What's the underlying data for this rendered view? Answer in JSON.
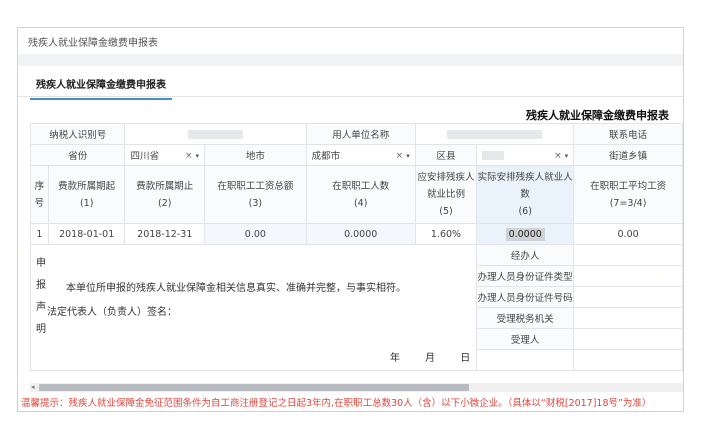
{
  "window": {
    "title": "残疾人就业保障金缴费申报表"
  },
  "tab": {
    "label": "残疾人就业保障金缴费申报表"
  },
  "form": {
    "title": "残疾人就业保障金缴费申报表"
  },
  "row1": {
    "taxpayer_id_label": "纳税人识别号",
    "employer_name_label": "用人单位名称",
    "phone_label": "联系电话"
  },
  "row2": {
    "province_label": "省份",
    "province_value": "四川省",
    "city_label": "地市",
    "city_value": "成都市",
    "district_label": "区县",
    "street_label": "街道乡镇"
  },
  "header": {
    "seq": "序号",
    "period_start": "费款所属期起",
    "period_start_n": "(1)",
    "period_end": "费款所属期止",
    "period_end_n": "(2)",
    "total_wage": "在职职工工资总额",
    "total_wage_n": "(3)",
    "staff_count": "在职职工人数",
    "staff_count_n": "(4)",
    "ratio": "应安排残疾人就业比例",
    "ratio_n": "(5)",
    "actual": "实际安排残疾人就业人数",
    "actual_n": "(6)",
    "avg_wage": "在职职工平均工资",
    "avg_wage_n": "(7=3/4)"
  },
  "row_data": {
    "seq": "1",
    "period_start": "2018-01-01",
    "period_end": "2018-12-31",
    "total_wage": "0.00",
    "staff_count": "0.0000",
    "ratio": "1.60%",
    "actual": "0.0000",
    "avg_wage": "0.00"
  },
  "declaration": {
    "vertical_label": "申报声明",
    "text": "本单位所申报的残疾人就业保障金相关信息真实、准确并完整，与事实相符。",
    "sign": "法定代表人（负责人）签名：",
    "date": "年 月 日"
  },
  "right_labels": [
    "经办人",
    "办理人员身份证件类型",
    "办理人员身份证件号码",
    "受理税务机关",
    "受理人"
  ],
  "clear_mark": "×",
  "caret": "▾",
  "scroll_arrow": "◂",
  "hint": "温馨提示：残疾人就业保障金免征范围条件为自工商注册登记之日起3年内,在职职工总数30人（含）以下小微企业。（具体以“财税[2017]18号”为准）"
}
